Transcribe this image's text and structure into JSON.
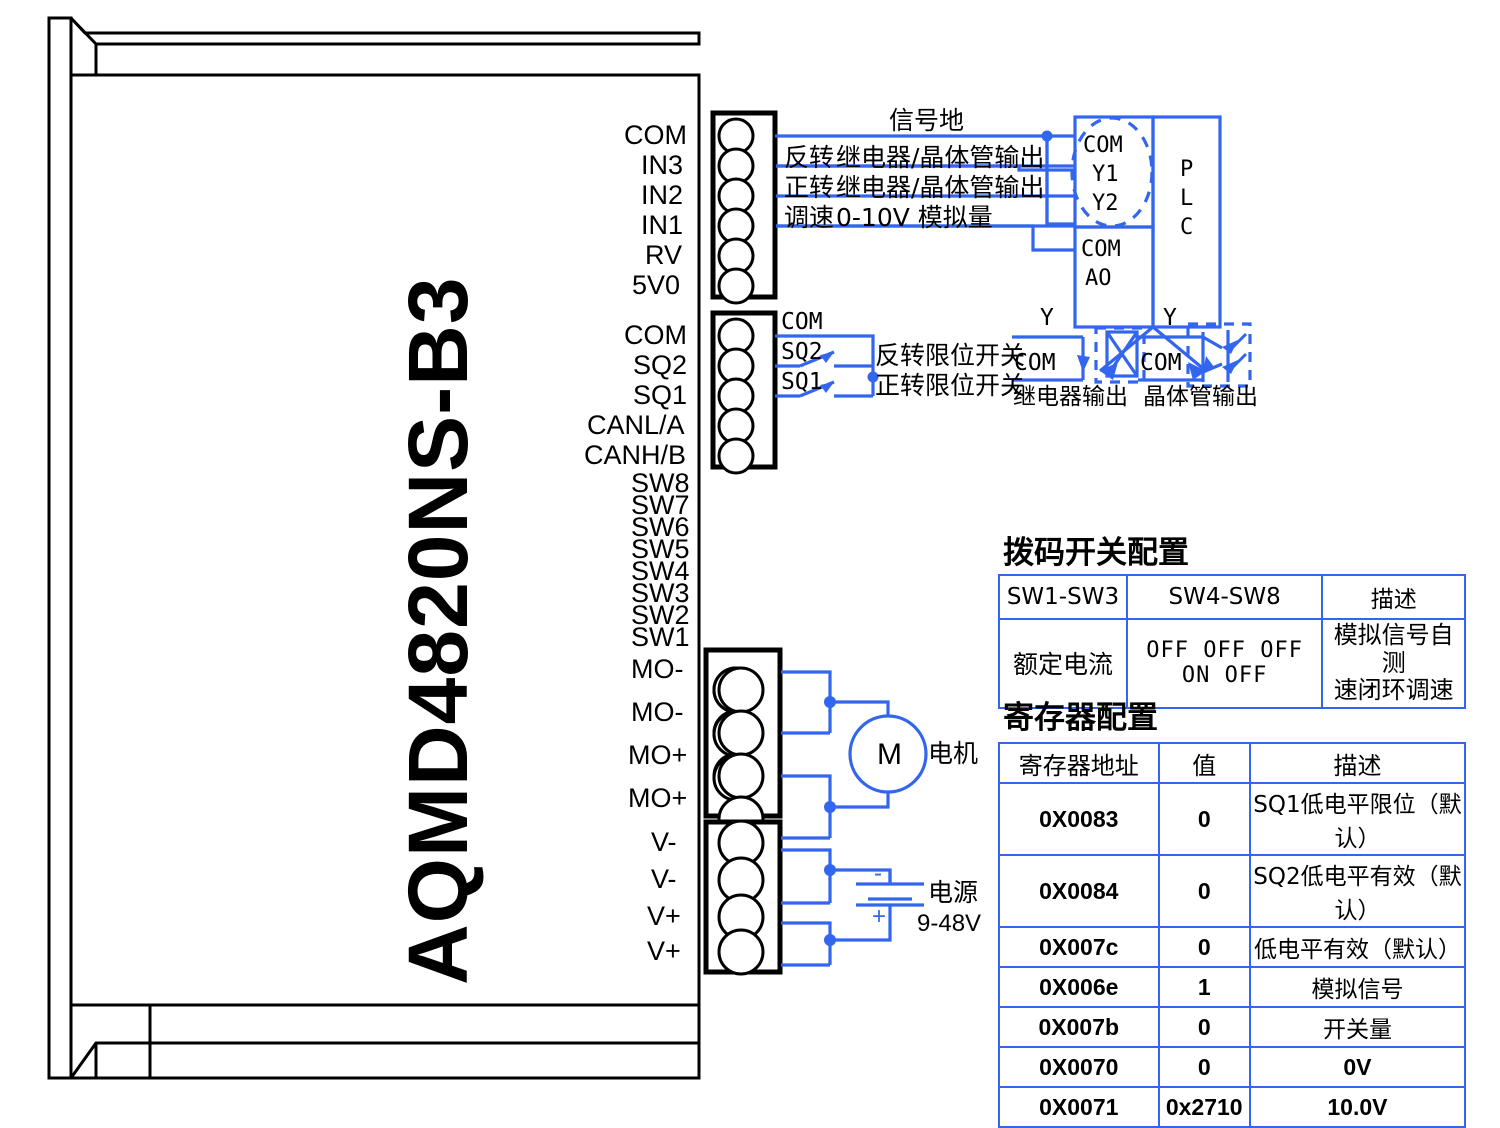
{
  "device": {
    "name": "AQMD4820NS-B3",
    "terminal_groups": [
      {
        "name": "signal-terminal-block",
        "pins": [
          "COM",
          "IN3",
          "IN2",
          "IN1",
          "RV",
          "5V0"
        ]
      },
      {
        "name": "limit-terminal-block",
        "pins": [
          "COM",
          "SQ2",
          "SQ1",
          "CANL/A",
          "CANH/B"
        ]
      },
      {
        "name": "dip-switch-labels",
        "pins": [
          "SW8",
          "SW7",
          "SW6",
          "SW5",
          "SW4",
          "SW3",
          "SW2",
          "SW1"
        ]
      },
      {
        "name": "motor-terminal-block",
        "pins": [
          "MO-",
          "MO-",
          "MO+",
          "MO+"
        ]
      },
      {
        "name": "power-terminal-block",
        "pins": [
          "V-",
          "V-",
          "V+",
          "V+"
        ]
      }
    ]
  },
  "wiring": {
    "signal_ground": "信号地",
    "rows": [
      {
        "func": "反转",
        "desc": "继电器/晶体管输出"
      },
      {
        "func": "正转",
        "desc": "继电器/晶体管输出"
      },
      {
        "func": "调速",
        "desc": "0-10V 模拟量"
      }
    ],
    "limit": {
      "com": "COM",
      "sq2_label": "SQ2",
      "sq1_label": "SQ1",
      "sq2_desc": "反转限位开关",
      "sq1_desc": "正转限位开关"
    },
    "motor": {
      "symbol": "M",
      "label": "电机"
    },
    "power": {
      "label": "电源",
      "voltage": "9-48V",
      "plus": "+",
      "minus": "-"
    }
  },
  "plc": {
    "title": "PLC",
    "title_chars": [
      "P",
      "L",
      "C"
    ],
    "upper_pins": [
      "COM",
      "Y1",
      "Y2"
    ],
    "lower_pins": [
      "COM",
      "AO"
    ],
    "outputs": [
      {
        "name": "relay-output",
        "y_label": "Y",
        "com_label": "COM",
        "caption": "继电器输出"
      },
      {
        "name": "transistor-output",
        "y_label": "Y",
        "com_label": "COM",
        "caption": "晶体管输出"
      }
    ]
  },
  "dip_table": {
    "title": "拨码开关配置",
    "headers": [
      "SW1-SW3",
      "SW4-SW8",
      "描述"
    ],
    "row": [
      "额定电流",
      "OFF  OFF  OFF  ON  OFF",
      "模拟信号自测\n速闭环调速"
    ],
    "row_desc_line1": "模拟信号自测",
    "row_desc_line2": "速闭环调速"
  },
  "register_table": {
    "title": "寄存器配置",
    "headers": [
      "寄存器地址",
      "值",
      "描述"
    ],
    "rows": [
      {
        "address": "0X0083",
        "value": "0",
        "desc": "SQ1低电平限位（默认）"
      },
      {
        "address": "0X0084",
        "value": "0",
        "desc": "SQ2低电平有效（默认）"
      },
      {
        "address": "0X007c",
        "value": "0",
        "desc": "低电平有效（默认）"
      },
      {
        "address": "0X006e",
        "value": "1",
        "desc": "模拟信号"
      },
      {
        "address": "0X007b",
        "value": "0",
        "desc": "开关量"
      },
      {
        "address": "0X0070",
        "value": "0",
        "desc": "0V"
      },
      {
        "address": "0X0071",
        "value": "0x2710",
        "desc": "10.0V"
      }
    ]
  },
  "colors": {
    "wire": "#3366ee",
    "outline": "#000000",
    "table_border": "#3366ee"
  }
}
